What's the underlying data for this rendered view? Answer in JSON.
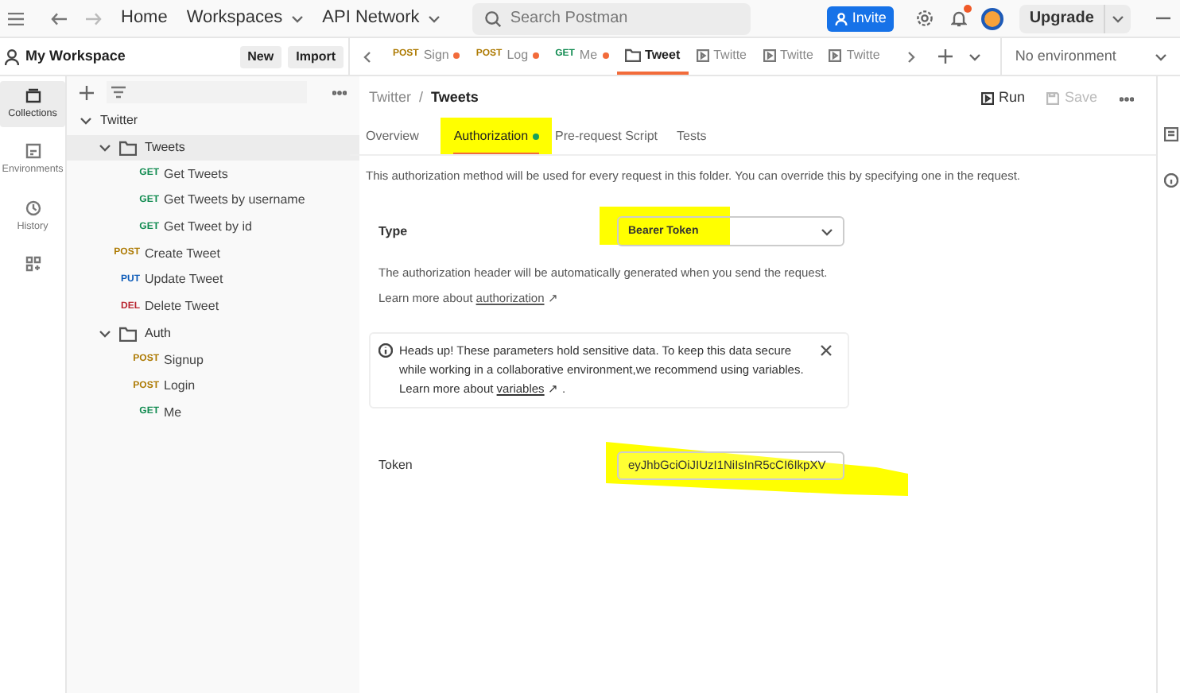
{
  "top_bar": {
    "nav": [
      "Home",
      "Workspaces",
      "API Network"
    ],
    "search": {
      "placeholder": "Search Postman"
    },
    "invite": "Invite",
    "notification_dot": true,
    "upgrade": "Upgrade"
  },
  "workspace": {
    "title": "My Workspace",
    "buttons": [
      "New",
      "Import"
    ]
  },
  "rail": [
    {
      "label": "Collections",
      "selected": true
    },
    {
      "label": "Environments",
      "selected": false
    },
    {
      "label": "History",
      "selected": false
    },
    {
      "selected": false
    }
  ],
  "tree": [
    {
      "label": "Twitter",
      "kind": "collection",
      "expanded": true,
      "children": [
        {
          "label": "Tweets",
          "kind": "folder",
          "expanded": true,
          "selected": true,
          "children": [
            {
              "method": "GET",
              "label": "Get Tweets",
              "kind": "request"
            },
            {
              "method": "GET",
              "label": "Get Tweets by username",
              "kind": "request"
            },
            {
              "method": "GET",
              "label": "Get Tweet by id",
              "kind": "request"
            }
          ]
        },
        {
          "method": "POST",
          "label": "Create Tweet",
          "kind": "request"
        },
        {
          "method": "PUT",
          "label": "Update Tweet",
          "kind": "request"
        },
        {
          "method": "DEL",
          "label": "Delete Tweet",
          "kind": "request"
        },
        {
          "label": "Auth",
          "kind": "folder",
          "expanded": true,
          "selected": false,
          "children": [
            {
              "method": "POST",
              "label": "Signup",
              "kind": "request"
            },
            {
              "method": "POST",
              "label": "Login",
              "kind": "request"
            },
            {
              "method": "GET",
              "label": "Me",
              "kind": "request"
            }
          ]
        }
      ]
    }
  ],
  "open_tabs": [
    {
      "kind": "request",
      "method": "POST",
      "label": "Sign",
      "unsaved": true,
      "selected": false
    },
    {
      "kind": "request",
      "method": "POST",
      "label": "Log",
      "unsaved": true,
      "selected": false
    },
    {
      "kind": "request",
      "method": "GET",
      "label": "Me",
      "unsaved": true,
      "selected": false
    },
    {
      "kind": "folder",
      "label": "Tweet",
      "unsaved": false,
      "selected": true
    },
    {
      "kind": "example",
      "label": "Twitte",
      "unsaved": false,
      "selected": false
    },
    {
      "kind": "example",
      "label": "Twitte",
      "unsaved": false,
      "selected": false
    },
    {
      "kind": "example",
      "label": "Twitte",
      "unsaved": false,
      "selected": false
    }
  ],
  "environment": "No environment",
  "breadcrumb": [
    "Twitter",
    "/",
    "Tweets"
  ],
  "actions": {
    "run": "Run",
    "save": "Save"
  },
  "sub_tabs": [
    {
      "label": "Overview",
      "selected": false,
      "dot": false,
      "highlighted": false
    },
    {
      "label": "Authorization",
      "selected": true,
      "dot": true,
      "highlighted": true
    },
    {
      "label": "Pre-request Script",
      "selected": false,
      "dot": false,
      "highlighted": false
    },
    {
      "label": "Tests",
      "selected": false,
      "dot": false,
      "highlighted": false
    }
  ],
  "description": "This authorization method will be used for every request in this folder. You can override this by specifying one in the request.",
  "type": {
    "label": "Type",
    "value": "Bearer Token",
    "highlighted": true
  },
  "type_help": {
    "text": "The authorization header will be automatically generated when you send the request.",
    "learn": "Learn more about",
    "link": "authorization",
    "arrow": "↗"
  },
  "notice": {
    "text": "Heads up! These parameters hold sensitive data. To keep this data secure while working in a collaborative environment,we recommend using variables.",
    "learn": "Learn more about",
    "link": "variables",
    "arrow": "↗",
    "end": "."
  },
  "token": {
    "label": "Token",
    "value": "eyJhbGciOiJIUzI1NiIsInR5cCI6IkpXV",
    "highlighted": true
  }
}
